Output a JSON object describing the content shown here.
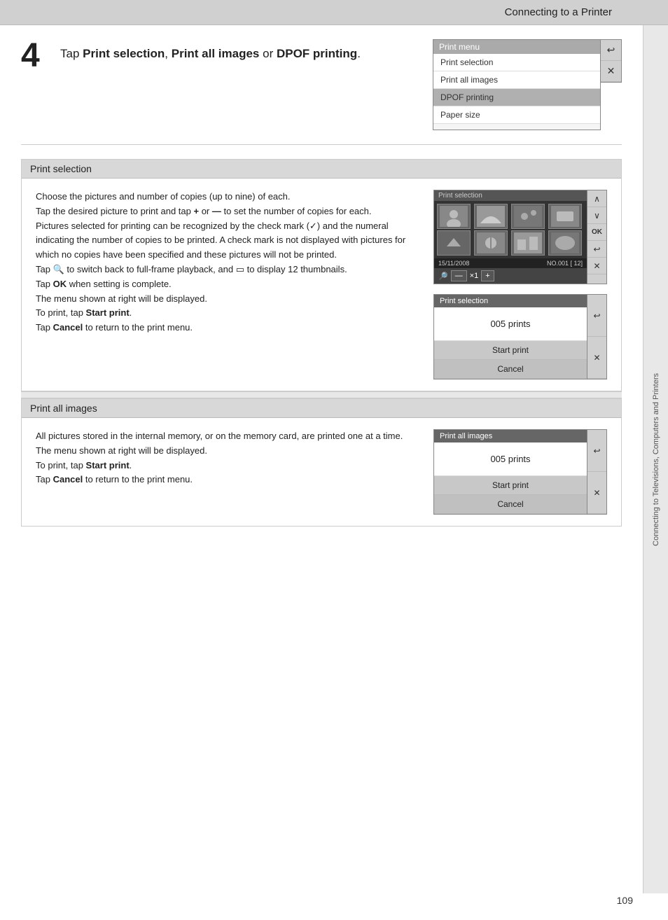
{
  "header": {
    "title": "Connecting to a Printer",
    "page_number": "109"
  },
  "right_sidebar": {
    "text": "Connecting to Televisions, Computers and Printers"
  },
  "step4": {
    "number": "4",
    "text_before": "Tap ",
    "bold1": "Print selection",
    "comma": ", ",
    "bold2": "Print all images",
    "text_mid": " or ",
    "bold3": "DPOF printing",
    "text_end": "."
  },
  "print_menu": {
    "header": "Print menu",
    "items": [
      {
        "label": "Print selection",
        "selected": false
      },
      {
        "label": "Print all images",
        "selected": false
      },
      {
        "label": "DPOF printing",
        "selected": true
      },
      {
        "label": "Paper size",
        "selected": false
      }
    ],
    "sidebar_buttons": [
      "↩",
      "✕"
    ]
  },
  "section_print_selection": {
    "title": "Print selection",
    "description": "Choose the pictures and number of copies (up to nine) of each.\nTap the desired picture to print and tap + or — to set the number of copies for each.\nPictures selected for printing can be recognized by the check mark (",
    "check_symbol": "✓",
    "description2": ") and the numeral indicating the number of copies to be printed. A check mark is not displayed with pictures for which no copies have been specified and these pictures will not be printed.",
    "line3": "Tap  to switch back to full-frame playback, and  to display 12 thumbnails.",
    "line4": "Tap OK when setting is complete.",
    "line5": "The menu shown at right will be displayed.",
    "line6": "To print, tap ",
    "bold_start_print": "Start print",
    "line7": ".",
    "line8": "Tap ",
    "bold_cancel": "Cancel",
    "line9": " to return to the print menu.",
    "thumb_screen": {
      "header": "Print selection",
      "date": "15/11/2008",
      "no": "NO.001 [  12]",
      "sidebar_buttons": [
        "∧",
        "∨",
        "OK",
        "↩",
        "✕"
      ]
    },
    "dialog_screen": {
      "header": "Print selection",
      "count_label": "005 prints",
      "buttons": [
        "Start print",
        "Cancel"
      ],
      "sidebar_buttons": [
        "↩",
        "✕"
      ]
    }
  },
  "section_print_all": {
    "title": "Print all images",
    "description": "All pictures stored in the internal memory, or on the memory card, are printed one at a time.\nThe menu shown at right will be displayed.\nTo print, tap ",
    "bold_start_print": "Start print",
    "line2": ".\nTap ",
    "bold_cancel": "Cancel",
    "line3": " to return to the print menu.",
    "dialog_screen": {
      "header": "Print all images",
      "count_label": "005 prints",
      "buttons": [
        "Start print",
        "Cancel"
      ],
      "sidebar_buttons": [
        "↩",
        "✕"
      ]
    }
  }
}
